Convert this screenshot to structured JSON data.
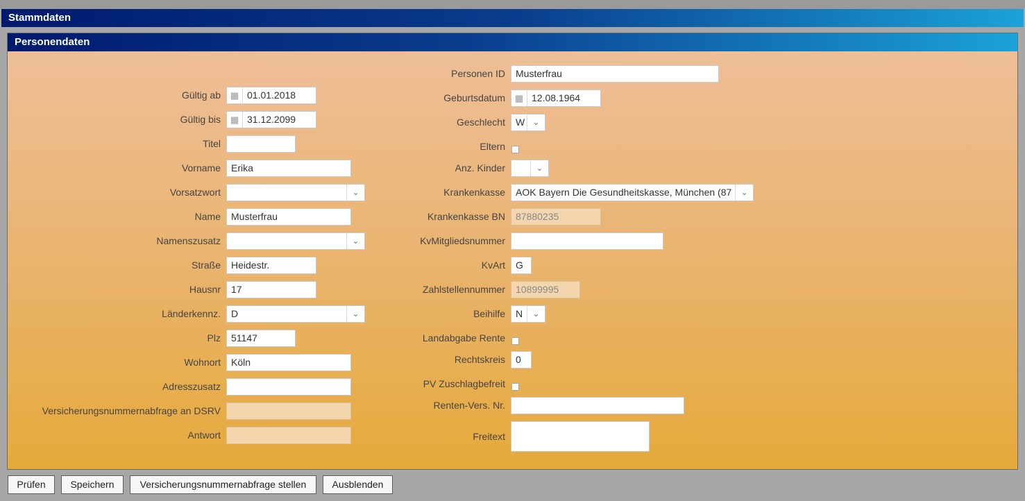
{
  "window": {
    "title": "Stammdaten"
  },
  "panel": {
    "title": "Personendaten"
  },
  "left": {
    "gueltig_ab": {
      "label": "Gültig ab",
      "value": "01.01.2018"
    },
    "gueltig_bis": {
      "label": "Gültig bis",
      "value": "31.12.2099"
    },
    "titel": {
      "label": "Titel",
      "value": ""
    },
    "vorname": {
      "label": "Vorname",
      "value": "Erika"
    },
    "vorsatzwort": {
      "label": "Vorsatzwort",
      "value": ""
    },
    "name": {
      "label": "Name",
      "value": "Musterfrau"
    },
    "namenszusatz": {
      "label": "Namenszusatz",
      "value": ""
    },
    "strasse": {
      "label": "Straße",
      "value": "Heidestr."
    },
    "hausnr": {
      "label": "Hausnr",
      "value": "17"
    },
    "laenderkennz": {
      "label": "Länderkennz.",
      "value": "D"
    },
    "plz": {
      "label": "Plz",
      "value": "51147"
    },
    "wohnort": {
      "label": "Wohnort",
      "value": "Köln"
    },
    "adresszusatz": {
      "label": "Adresszusatz",
      "value": ""
    },
    "vnr_abfrage": {
      "label": "Versicherungsnummernabfrage an DSRV",
      "value": ""
    },
    "antwort": {
      "label": "Antwort",
      "value": ""
    }
  },
  "right": {
    "personen_id": {
      "label": "Personen ID",
      "value": "Musterfrau"
    },
    "geburtsdatum": {
      "label": "Geburtsdatum",
      "value": "12.08.1964"
    },
    "geschlecht": {
      "label": "Geschlecht",
      "value": "W"
    },
    "eltern": {
      "label": "Eltern"
    },
    "anz_kinder": {
      "label": "Anz. Kinder",
      "value": ""
    },
    "krankenkasse": {
      "label": "Krankenkasse",
      "value": "AOK Bayern Die Gesundheitskasse, München (87"
    },
    "krankenkasse_bn": {
      "label": "Krankenkasse BN",
      "value": "87880235"
    },
    "kv_mitgliedsnummer": {
      "label": "KvMitgliedsnummer",
      "value": ""
    },
    "kvart": {
      "label": "KvArt",
      "value": "G"
    },
    "zahlstellennummer": {
      "label": "Zahlstellennummer",
      "value": "10899995"
    },
    "beihilfe": {
      "label": "Beihilfe",
      "value": "N"
    },
    "landabgabe_rente": {
      "label": "Landabgabe Rente"
    },
    "rechtskreis": {
      "label": "Rechtskreis",
      "value": "0"
    },
    "pv_zuschlagbefreit": {
      "label": "PV Zuschlagbefreit"
    },
    "renten_vers_nr": {
      "label": "Renten-Vers. Nr.",
      "value": ""
    },
    "freitext": {
      "label": "Freitext",
      "value": ""
    }
  },
  "buttons": {
    "pruefen": "Prüfen",
    "speichern": "Speichern",
    "vnr_abfrage": "Versicherungsnummernabfrage stellen",
    "ausblenden": "Ausblenden"
  },
  "icons": {
    "calendar": "calendar-icon",
    "chevron": "chevron-down-icon"
  },
  "colors": {
    "header_dark": "#001a6e",
    "header_light": "#1ba2d8",
    "panel_top": "#efbf9b",
    "panel_bottom": "#e6aa3a"
  }
}
